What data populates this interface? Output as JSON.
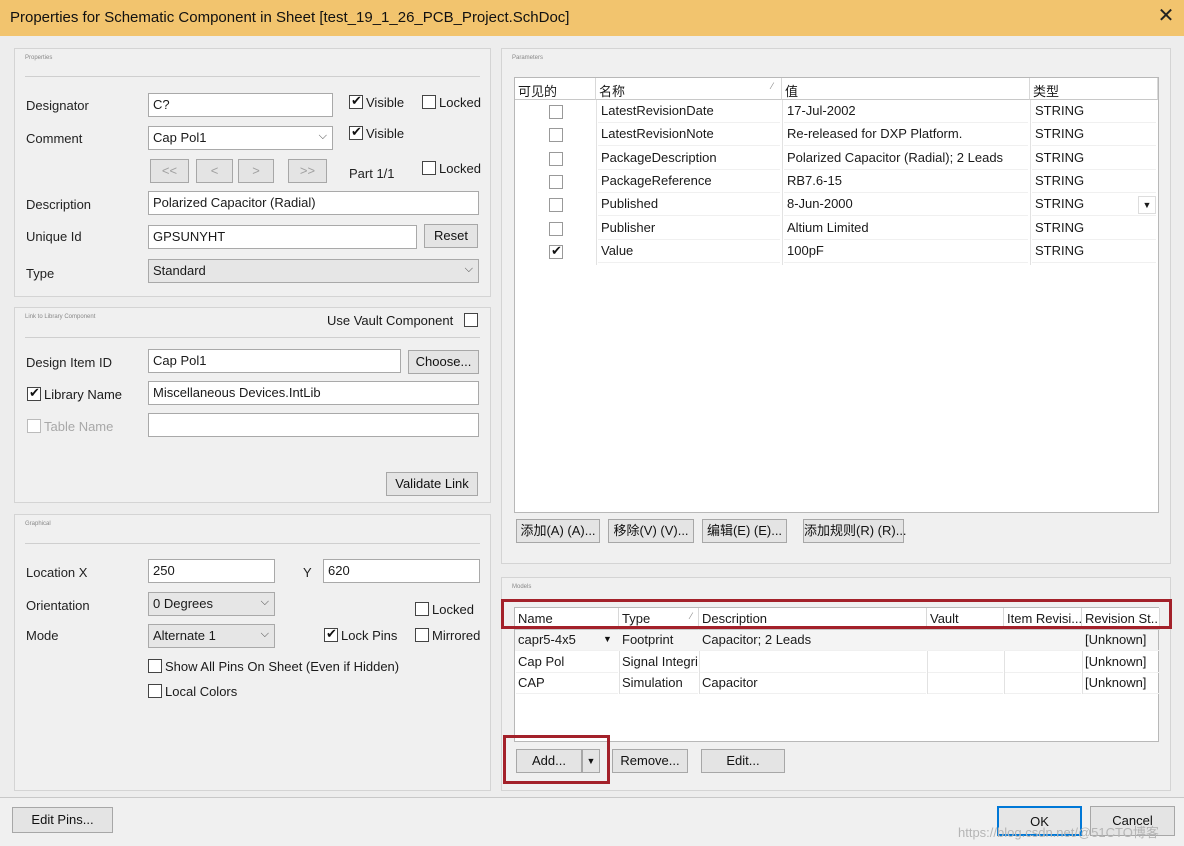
{
  "window": {
    "title": "Properties for Schematic Component in Sheet [test_19_1_26_PCB_Project.SchDoc]",
    "close_icon": "close-icon"
  },
  "properties": {
    "group_title": "Properties",
    "designator_label": "Designator",
    "designator_value": "C?",
    "designator_visible_label": "Visible",
    "designator_visible": true,
    "designator_locked_label": "Locked",
    "designator_locked": false,
    "comment_label": "Comment",
    "comment_value": "Cap Pol1",
    "comment_visible_label": "Visible",
    "comment_visible": true,
    "nav_first": "<<",
    "nav_prev": "<",
    "nav_next": ">",
    "nav_last": ">>",
    "part_label": "Part 1/1",
    "part_locked_label": "Locked",
    "part_locked": false,
    "description_label": "Description",
    "description_value": "Polarized Capacitor (Radial)",
    "unique_id_label": "Unique Id",
    "unique_id_value": "GPSUNYHT",
    "reset_label": "Reset",
    "type_label": "Type",
    "type_value": "Standard"
  },
  "library_link": {
    "group_title": "Link to Library Component",
    "use_vault_label": "Use Vault Component",
    "use_vault": false,
    "design_item_label": "Design Item ID",
    "design_item_value": "Cap Pol1",
    "choose_label": "Choose...",
    "library_name_label": "Library Name",
    "library_name_checked": true,
    "library_name_value": "Miscellaneous Devices.IntLib",
    "table_name_label": "Table Name",
    "table_name_checked": false,
    "table_name_value": "",
    "validate_label": "Validate Link"
  },
  "graphical": {
    "group_title": "Graphical",
    "location_label": "Location  X",
    "x_value": "250",
    "y_label": "Y",
    "y_value": "620",
    "orientation_label": "Orientation",
    "orientation_value": "0 Degrees",
    "locked_label": "Locked",
    "locked": false,
    "mode_label": "Mode",
    "mode_value": "Alternate 1",
    "lock_pins_label": "Lock Pins",
    "lock_pins": true,
    "mirrored_label": "Mirrored",
    "mirrored": false,
    "show_all_pins_label": "Show All Pins On Sheet (Even if Hidden)",
    "show_all_pins": false,
    "local_colors_label": "Local Colors",
    "local_colors": false
  },
  "parameters": {
    "group_title": "Parameters",
    "columns": [
      "可见的",
      "名称",
      "值",
      "类型"
    ],
    "rows": [
      {
        "visible": false,
        "name": "LatestRevisionDate",
        "value": "17-Jul-2002",
        "type": "STRING"
      },
      {
        "visible": false,
        "name": "LatestRevisionNote",
        "value": "Re-released for DXP Platform.",
        "type": "STRING"
      },
      {
        "visible": false,
        "name": "PackageDescription",
        "value": "Polarized Capacitor (Radial); 2 Leads",
        "type": "STRING"
      },
      {
        "visible": false,
        "name": "PackageReference",
        "value": "RB7.6-15",
        "type": "STRING"
      },
      {
        "visible": false,
        "name": "Published",
        "value": "8-Jun-2000",
        "type": "STRING"
      },
      {
        "visible": false,
        "name": "Publisher",
        "value": "Altium Limited",
        "type": "STRING"
      },
      {
        "visible": true,
        "name": "Value",
        "value": "100pF",
        "type": "STRING"
      }
    ],
    "add_label": "添加(A) (A)...",
    "remove_label": "移除(V) (V)...",
    "edit_label": "编辑(E) (E)...",
    "add_rule_label": "添加规则(R) (R)..."
  },
  "models": {
    "group_title": "Models",
    "columns": [
      "Name",
      "Type",
      "Description",
      "Vault",
      "Item Revisi...",
      "Revision St..."
    ],
    "rows": [
      {
        "name": "capr5-4x5",
        "type": "Footprint",
        "description": "Capacitor; 2 Leads",
        "vault": "",
        "item_revision": "",
        "revision_state": "[Unknown]"
      },
      {
        "name": "Cap Pol",
        "type": "Signal Integrity",
        "description": "",
        "vault": "",
        "item_revision": "",
        "revision_state": "[Unknown]"
      },
      {
        "name": "CAP",
        "type": "Simulation",
        "description": "Capacitor",
        "vault": "",
        "item_revision": "",
        "revision_state": "[Unknown]"
      }
    ],
    "add_label": "Add...",
    "remove_label": "Remove...",
    "edit_label": "Edit..."
  },
  "footer": {
    "edit_pins_label": "Edit Pins...",
    "ok_label": "OK",
    "cancel_label": "Cancel",
    "watermark": "https://blog.csdn.net/@51CTO博客"
  },
  "colors": {
    "titlebar": "#f2c46e",
    "highlight_box": "#a3212a",
    "ok_border": "#0078d7"
  }
}
